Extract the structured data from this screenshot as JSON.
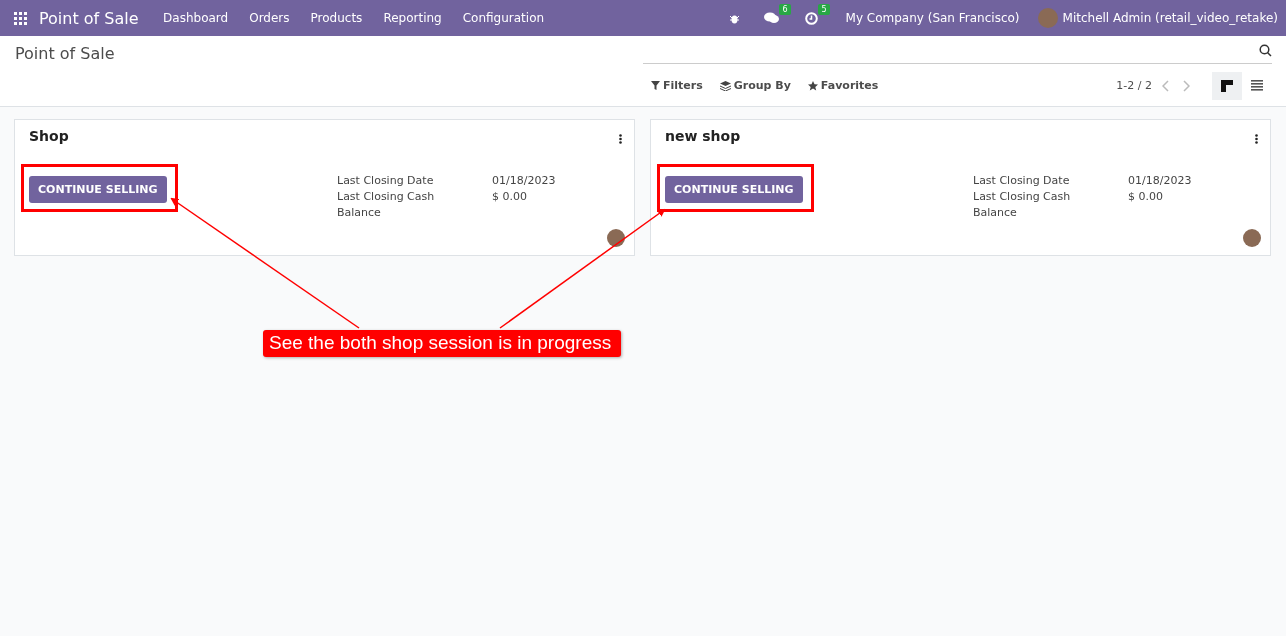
{
  "navbar": {
    "app_name": "Point of Sale",
    "menu": [
      "Dashboard",
      "Orders",
      "Products",
      "Reporting",
      "Configuration"
    ],
    "messages_count": "6",
    "activities_count": "5",
    "company": "My Company (San Francisco)",
    "user": "Mitchell Admin (retail_video_retake)"
  },
  "control_panel": {
    "title": "Point of Sale",
    "filters": [
      "Filters",
      "Group By",
      "Favorites"
    ],
    "pager": "1-2 / 2",
    "views": [
      {
        "kind": "kanban",
        "selected": true
      },
      {
        "kind": "list",
        "selected": false
      }
    ]
  },
  "cards": [
    {
      "name": "Shop",
      "button": "CONTINUE SELLING",
      "highlighted": true,
      "fields": [
        {
          "label": "Last Closing Date",
          "value": "01/18/2023"
        },
        {
          "label": "Last Closing Cash",
          "value": "$ 0.00"
        },
        {
          "label": "Balance"
        }
      ]
    },
    {
      "name": "new shop",
      "button": "CONTINUE SELLING",
      "highlighted": true,
      "fields": [
        {
          "label": "Last Closing Date",
          "value": "01/18/2023"
        },
        {
          "label": "Last Closing Cash",
          "value": "$ 0.00"
        },
        {
          "label": "Balance"
        }
      ]
    }
  ],
  "annotation": {
    "text": "See the both shop session is in progress"
  }
}
